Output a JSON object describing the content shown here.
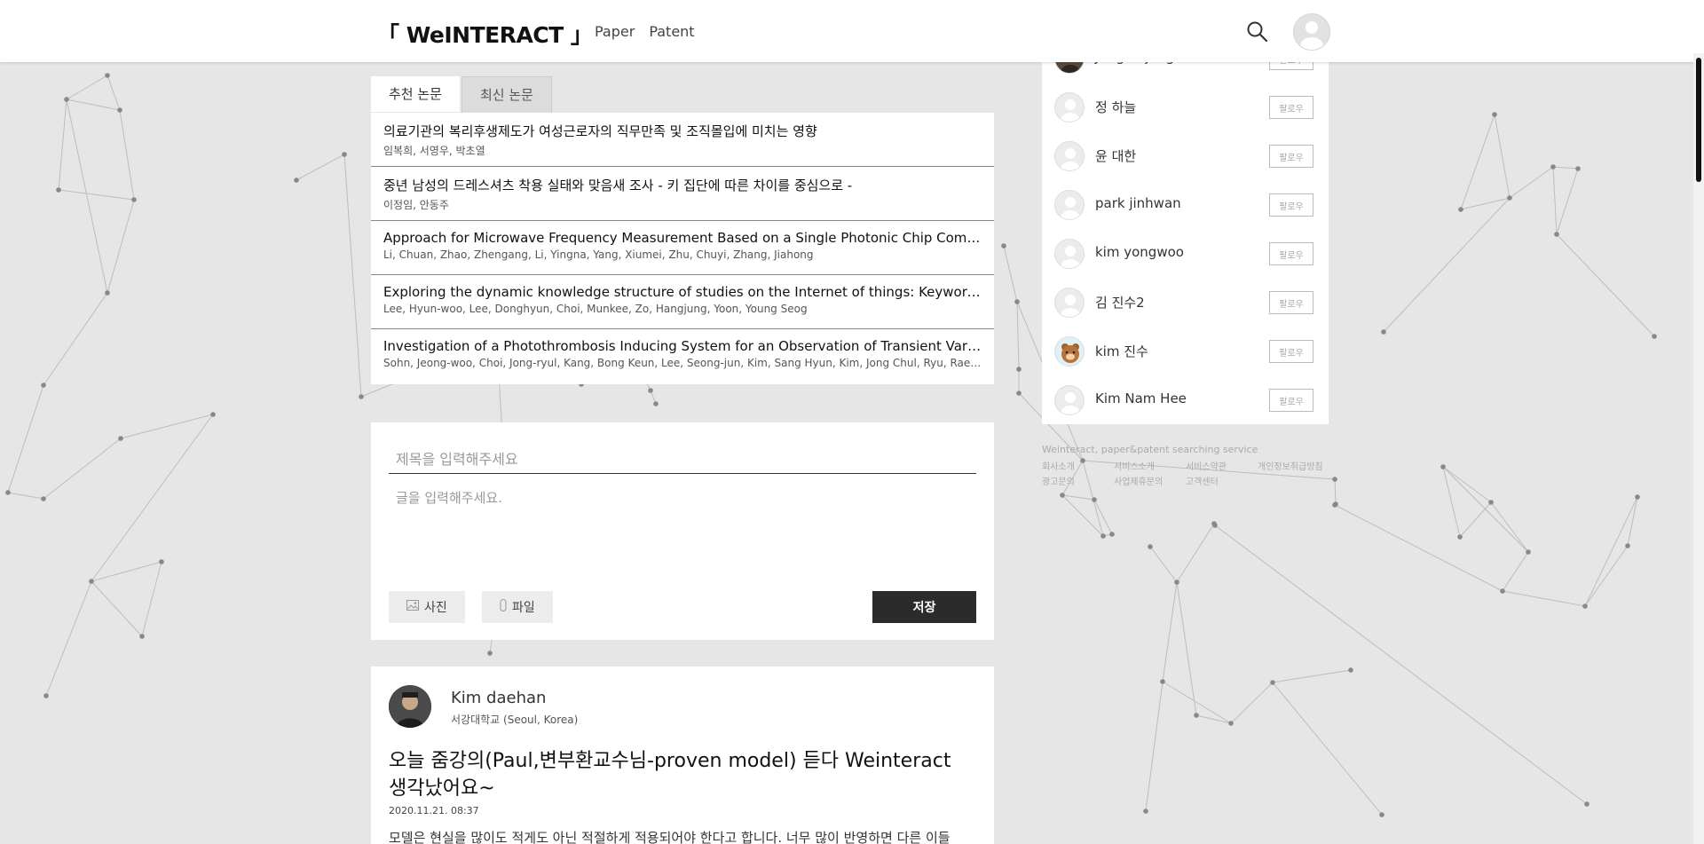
{
  "header": {
    "logo": "「 WeINTERACT 」",
    "nav": [
      "Paper",
      "Patent"
    ],
    "search_icon": "search-icon",
    "profile_icon": "user-avatar-icon"
  },
  "tabs": [
    {
      "label": "추천 논문",
      "active": true
    },
    {
      "label": "최신 논문",
      "active": false
    }
  ],
  "papers": [
    {
      "title": "의료기관의 복리후생제도가 여성근로자의 직무만족 및 조직몰입에 미치는 영향",
      "authors": "임복희, 서영우, 박초열"
    },
    {
      "title": "중년 남성의 드레스셔츠 착용 실태와 맞음새 조사 - 키 집단에 따른 차이를 중심으로 -",
      "authors": "이정임, 안동주"
    },
    {
      "title": "Approach for Microwave Frequency Measurement Based on a Single Photonic Chip Combined with ...",
      "authors": "Li, Chuan, Zhao, Zhengang, Li, Yingna, Yang, Xiumei, Zhu, Chuyi, Zhang, Jiahong"
    },
    {
      "title": "Exploring the dynamic knowledge structure of studies on the Internet of things: Keyword analysis",
      "authors": "Lee, Hyun-woo, Lee, Donghyun, Choi, Munkee, Zo, Hangjung, Yoon, Young Seog"
    },
    {
      "title": "Investigation of a Photothrombosis Inducing System for an Observation of Transient Variations in a...",
      "authors": "Sohn, Jeong-woo, Choi, Jong-ryul, Kang, Bong Keun, Lee, Seong-jun, Kim, Sang Hyun, Kim, Jong Chul, Ryu, Rae-Hyung, Ki..."
    }
  ],
  "composer": {
    "title_placeholder": "제목을 입력해주세요",
    "body_placeholder": "글을 입력해주세요.",
    "photo_label": "사진",
    "file_label": "파일",
    "save_label": "저장",
    "photo_icon": "image-icon",
    "file_icon": "paperclip-icon"
  },
  "post": {
    "author": "Kim daehan",
    "affiliation": "서강대학교 (Seoul, Korea)",
    "title": "오늘 줌강의(Paul,변부환교수님-proven model) 듣다 Weinteract 생각났어요~",
    "date": "2020.11.21. 08:37",
    "body": "모델은 현실을 많이도 적게도 아닌 적절하게 적용되어야 한다고 합니다. 너무 많이 반영하면 다른 이들"
  },
  "follow_suggestions": [
    {
      "name": "Jung Sajung",
      "button": "팔로우"
    },
    {
      "name": "정 하늘",
      "button": "팔로우"
    },
    {
      "name": "윤 대한",
      "button": "팔로우"
    },
    {
      "name": "park jinhwan",
      "button": "팔로우"
    },
    {
      "name": "kim yongwoo",
      "button": "팔로우"
    },
    {
      "name": "김 진수2",
      "button": "팔로우"
    },
    {
      "name": "kim 진수",
      "button": "팔로우"
    },
    {
      "name": "Kim Nam Hee",
      "button": "팔로우"
    }
  ],
  "footer": {
    "tagline": "Weinteract, paper&patent searching service",
    "links": [
      "회사소개",
      "서비스소개",
      "서비스약관",
      "개인정보취급방침",
      "광고문의",
      "사업제휴문의",
      "고객센터"
    ]
  },
  "colors": {
    "background": "#e6e6e6",
    "save_button": "#2b2b2b",
    "card": "#ffffff"
  }
}
